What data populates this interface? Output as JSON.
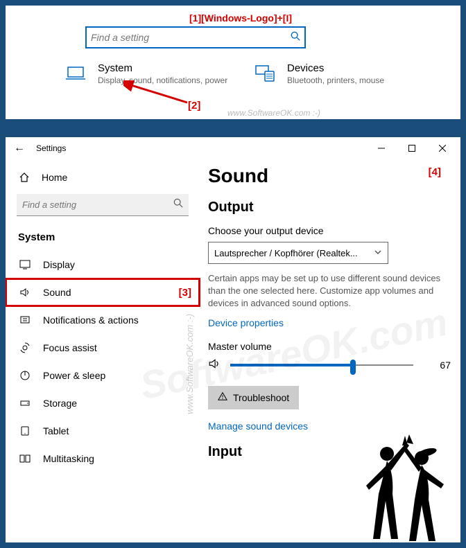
{
  "annotations": {
    "a1": "[1][Windows-Logo]+[I]",
    "a2": "[2]",
    "a3": "[3]",
    "a4": "[4]"
  },
  "watermark": "www.SoftwareOK.com :-)",
  "watermark_vert": "www.SoftwareOK.com :-)",
  "watermark_big": "SoftwareOK.com",
  "top": {
    "search_placeholder": "Find a setting",
    "system": {
      "title": "System",
      "sub": "Display, sound, notifications, power"
    },
    "devices": {
      "title": "Devices",
      "sub": "Bluetooth, printers, mouse"
    }
  },
  "win": {
    "title": "Settings",
    "sidebar": {
      "home": "Home",
      "search_placeholder": "Find a setting",
      "header": "System",
      "items": [
        "Display",
        "Sound",
        "Notifications & actions",
        "Focus assist",
        "Power & sleep",
        "Storage",
        "Tablet",
        "Multitasking"
      ]
    },
    "main": {
      "h1": "Sound",
      "h2_output": "Output",
      "choose_label": "Choose your output device",
      "dropdown_value": "Lautsprecher / Kopfhörer (Realtek...",
      "desc": "Certain apps may be set up to use different sound devices than the one selected here. Customize app volumes and devices in advanced sound options.",
      "device_props_link": "Device properties",
      "master_volume_label": "Master volume",
      "volume_value": "67",
      "troubleshoot": "Troubleshoot",
      "manage_link": "Manage sound devices",
      "h2_input": "Input"
    }
  }
}
